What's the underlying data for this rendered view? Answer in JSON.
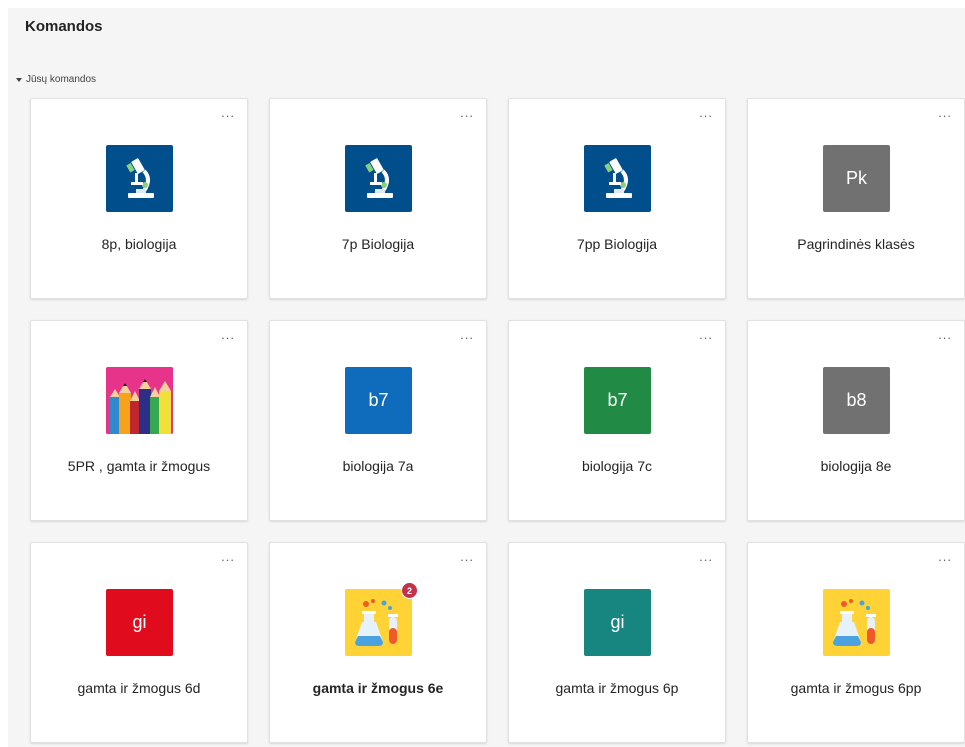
{
  "page": {
    "title": "Komandos"
  },
  "section": {
    "label": "Jūsų komandos"
  },
  "more_label": "...",
  "colors": {
    "microscope_bg": "#004e8c",
    "gray": "#717171",
    "blue": "#0f6cbd",
    "green": "#218b45",
    "red": "#e00b1c",
    "teal": "#178681",
    "yellow": "#ffd335",
    "pink": "#e8338a",
    "badge": "#c4314b"
  },
  "teams": [
    {
      "name": "8p, biologija",
      "icon": "microscope-icon"
    },
    {
      "name": "7p Biologija",
      "icon": "microscope-icon"
    },
    {
      "name": "7pp Biologija",
      "icon": "microscope-icon"
    },
    {
      "name": "Pagrindinės klasės",
      "initials": "Pk"
    },
    {
      "name": "5PR , gamta ir žmogus",
      "icon": "pencils-icon"
    },
    {
      "name": "biologija 7a",
      "initials": "b7"
    },
    {
      "name": "biologija 7c",
      "initials": "b7"
    },
    {
      "name": "biologija 8e",
      "initials": "b8"
    },
    {
      "name": "gamta ir žmogus 6d",
      "initials": "gi"
    },
    {
      "name": "gamta ir žmogus 6e",
      "icon": "flask-icon",
      "badge": "2"
    },
    {
      "name": "gamta ir žmogus 6p",
      "initials": "gi"
    },
    {
      "name": "gamta ir žmogus 6pp",
      "icon": "flask-icon"
    }
  ]
}
